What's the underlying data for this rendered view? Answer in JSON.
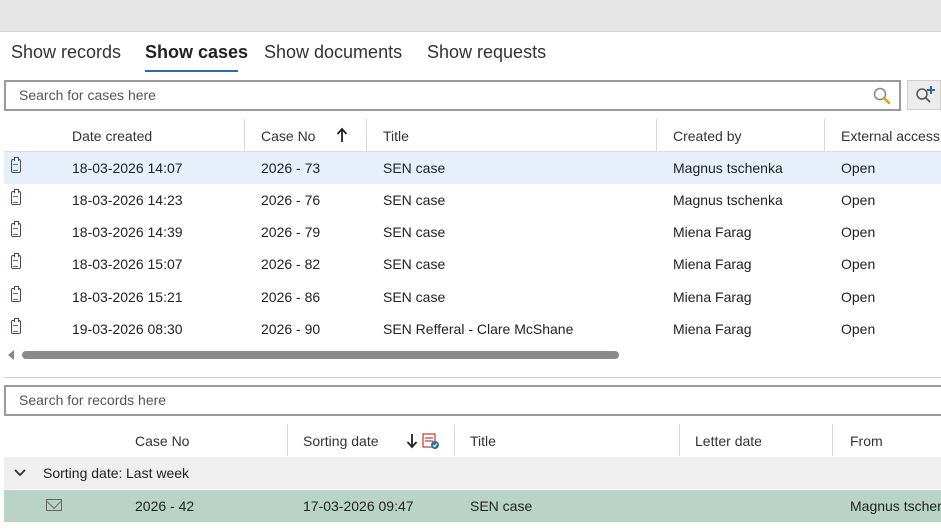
{
  "tabs": [
    {
      "label": "Show records",
      "active": false
    },
    {
      "label": "Show cases",
      "active": true
    },
    {
      "label": "Show documents",
      "active": false
    },
    {
      "label": "Show requests",
      "active": false
    }
  ],
  "cases_search": {
    "placeholder": "Search for cases here"
  },
  "cases_table": {
    "columns": [
      "Date created",
      "Case No",
      "Title",
      "Created by",
      "External access"
    ],
    "sort_column": "Case No",
    "sort_direction": "ascending",
    "rows": [
      {
        "date": "18-03-2026 14:07",
        "case_no": "2026 - 73",
        "title": "SEN case",
        "created_by": "Magnus tschenka",
        "access": "Open",
        "selected": true
      },
      {
        "date": "18-03-2026 14:23",
        "case_no": "2026 - 76",
        "title": "SEN case",
        "created_by": "Magnus tschenka",
        "access": "Open"
      },
      {
        "date": "18-03-2026 14:39",
        "case_no": "2026 - 79",
        "title": "SEN case",
        "created_by": "Miena Farag",
        "access": "Open"
      },
      {
        "date": "18-03-2026 15:07",
        "case_no": "2026 - 82",
        "title": "SEN case",
        "created_by": "Miena Farag",
        "access": "Open"
      },
      {
        "date": "18-03-2026 15:21",
        "case_no": "2026 - 86",
        "title": "SEN case",
        "created_by": "Miena Farag",
        "access": "Open"
      },
      {
        "date": "19-03-2026 08:30",
        "case_no": "2026 - 90",
        "title": "SEN Refferal - Clare McShane",
        "created_by": "Miena Farag",
        "access": "Open"
      }
    ]
  },
  "records_search": {
    "placeholder": "Search for records here"
  },
  "records_table": {
    "columns": [
      "Case No",
      "Sorting date",
      "Title",
      "Letter date",
      "From"
    ],
    "sort_column": "Sorting date",
    "sort_direction": "descending",
    "group": {
      "label": "Sorting date:",
      "value": "Last week"
    },
    "rows": [
      {
        "case_no": "2026 - 42",
        "sorting_date": "17-03-2026 09:47",
        "title": "SEN case",
        "letter_date": "",
        "from": "Magnus tschenka"
      }
    ]
  },
  "colors": {
    "accent": "#2b6cb0",
    "selected_row": "#e6f0fa",
    "record_row": "#b9d3c8"
  }
}
